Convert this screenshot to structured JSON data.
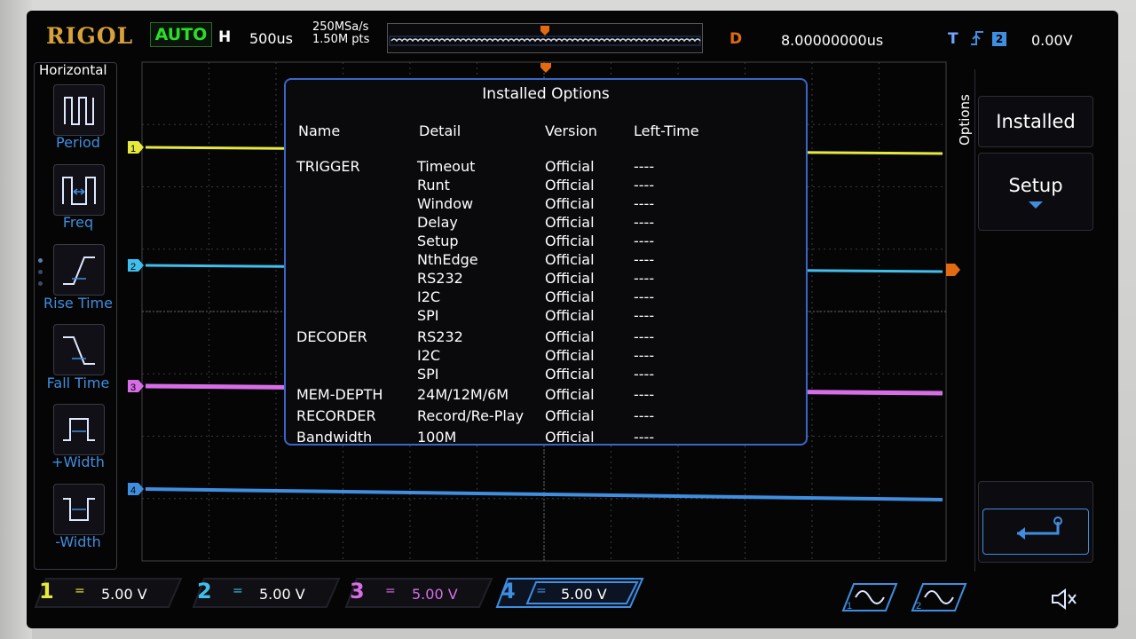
{
  "brand": "RIGOL",
  "trigger_mode": "AUTO",
  "horizontal": {
    "label": "H",
    "timebase": "500us",
    "sample_rate": "250MSa/s",
    "mem_depth": "1.50M pts"
  },
  "delay": {
    "label": "D",
    "value": "8.00000000us"
  },
  "trigger": {
    "label": "T",
    "source": "2",
    "level": "0.00V"
  },
  "left_menu": {
    "title": "Horizontal",
    "items": [
      {
        "label": "Period",
        "icon": "period-icon"
      },
      {
        "label": "Freq",
        "icon": "freq-icon"
      },
      {
        "label": "Rise Time",
        "icon": "rise-time-icon"
      },
      {
        "label": "Fall Time",
        "icon": "fall-time-icon"
      },
      {
        "label": "+Width",
        "icon": "positive-width-icon"
      },
      {
        "label": "-Width",
        "icon": "negative-width-icon"
      }
    ]
  },
  "dialog": {
    "title": "Installed Options",
    "columns": [
      "Name",
      "Detail",
      "Version",
      "Left-Time"
    ],
    "rows": [
      {
        "name": "TRIGGER",
        "detail": "Timeout",
        "version": "Official",
        "left_time": "----"
      },
      {
        "name": "",
        "detail": "Runt",
        "version": "Official",
        "left_time": "----"
      },
      {
        "name": "",
        "detail": "Window",
        "version": "Official",
        "left_time": "----"
      },
      {
        "name": "",
        "detail": "Delay",
        "version": "Official",
        "left_time": "----"
      },
      {
        "name": "",
        "detail": "Setup",
        "version": "Official",
        "left_time": "----"
      },
      {
        "name": "",
        "detail": "NthEdge",
        "version": "Official",
        "left_time": "----"
      },
      {
        "name": "",
        "detail": "RS232",
        "version": "Official",
        "left_time": "----"
      },
      {
        "name": "",
        "detail": "I2C",
        "version": "Official",
        "left_time": "----"
      },
      {
        "name": "",
        "detail": "SPI",
        "version": "Official",
        "left_time": "----"
      },
      {
        "name": "DECODER",
        "detail": "RS232",
        "version": "Official",
        "left_time": "----"
      },
      {
        "name": "",
        "detail": "I2C",
        "version": "Official",
        "left_time": "----"
      },
      {
        "name": "",
        "detail": "SPI",
        "version": "Official",
        "left_time": "----"
      },
      {
        "name": "MEM-DEPTH",
        "detail": "24M/12M/6M",
        "version": "Official",
        "left_time": "----"
      },
      {
        "name": "RECORDER",
        "detail": "Record/Re-Play",
        "version": "Official",
        "left_time": "----"
      },
      {
        "name": "Bandwidth",
        "detail": "100M",
        "version": "Official",
        "left_time": "----"
      }
    ]
  },
  "right_menu": {
    "title": "Options",
    "installed": "Installed",
    "setup": "Setup"
  },
  "channels": [
    {
      "num": "1",
      "coupling": "=",
      "scale": "5.00 V",
      "color": "#e6ea3c"
    },
    {
      "num": "2",
      "coupling": "=",
      "scale": "5.00 V",
      "color": "#3fc0ec"
    },
    {
      "num": "3",
      "coupling": "=",
      "scale": "5.00 V",
      "color": "#d86de8"
    },
    {
      "num": "4",
      "coupling": "=",
      "scale": "5.00 V",
      "color": "#3f8ee0"
    }
  ],
  "bottom_right": {
    "gen1": "1",
    "gen2": "2",
    "speaker": "speaker-muted-icon"
  },
  "colors": {
    "trigger": "#e36a10",
    "accent": "#3f8ee0",
    "auto": "#28e028"
  }
}
